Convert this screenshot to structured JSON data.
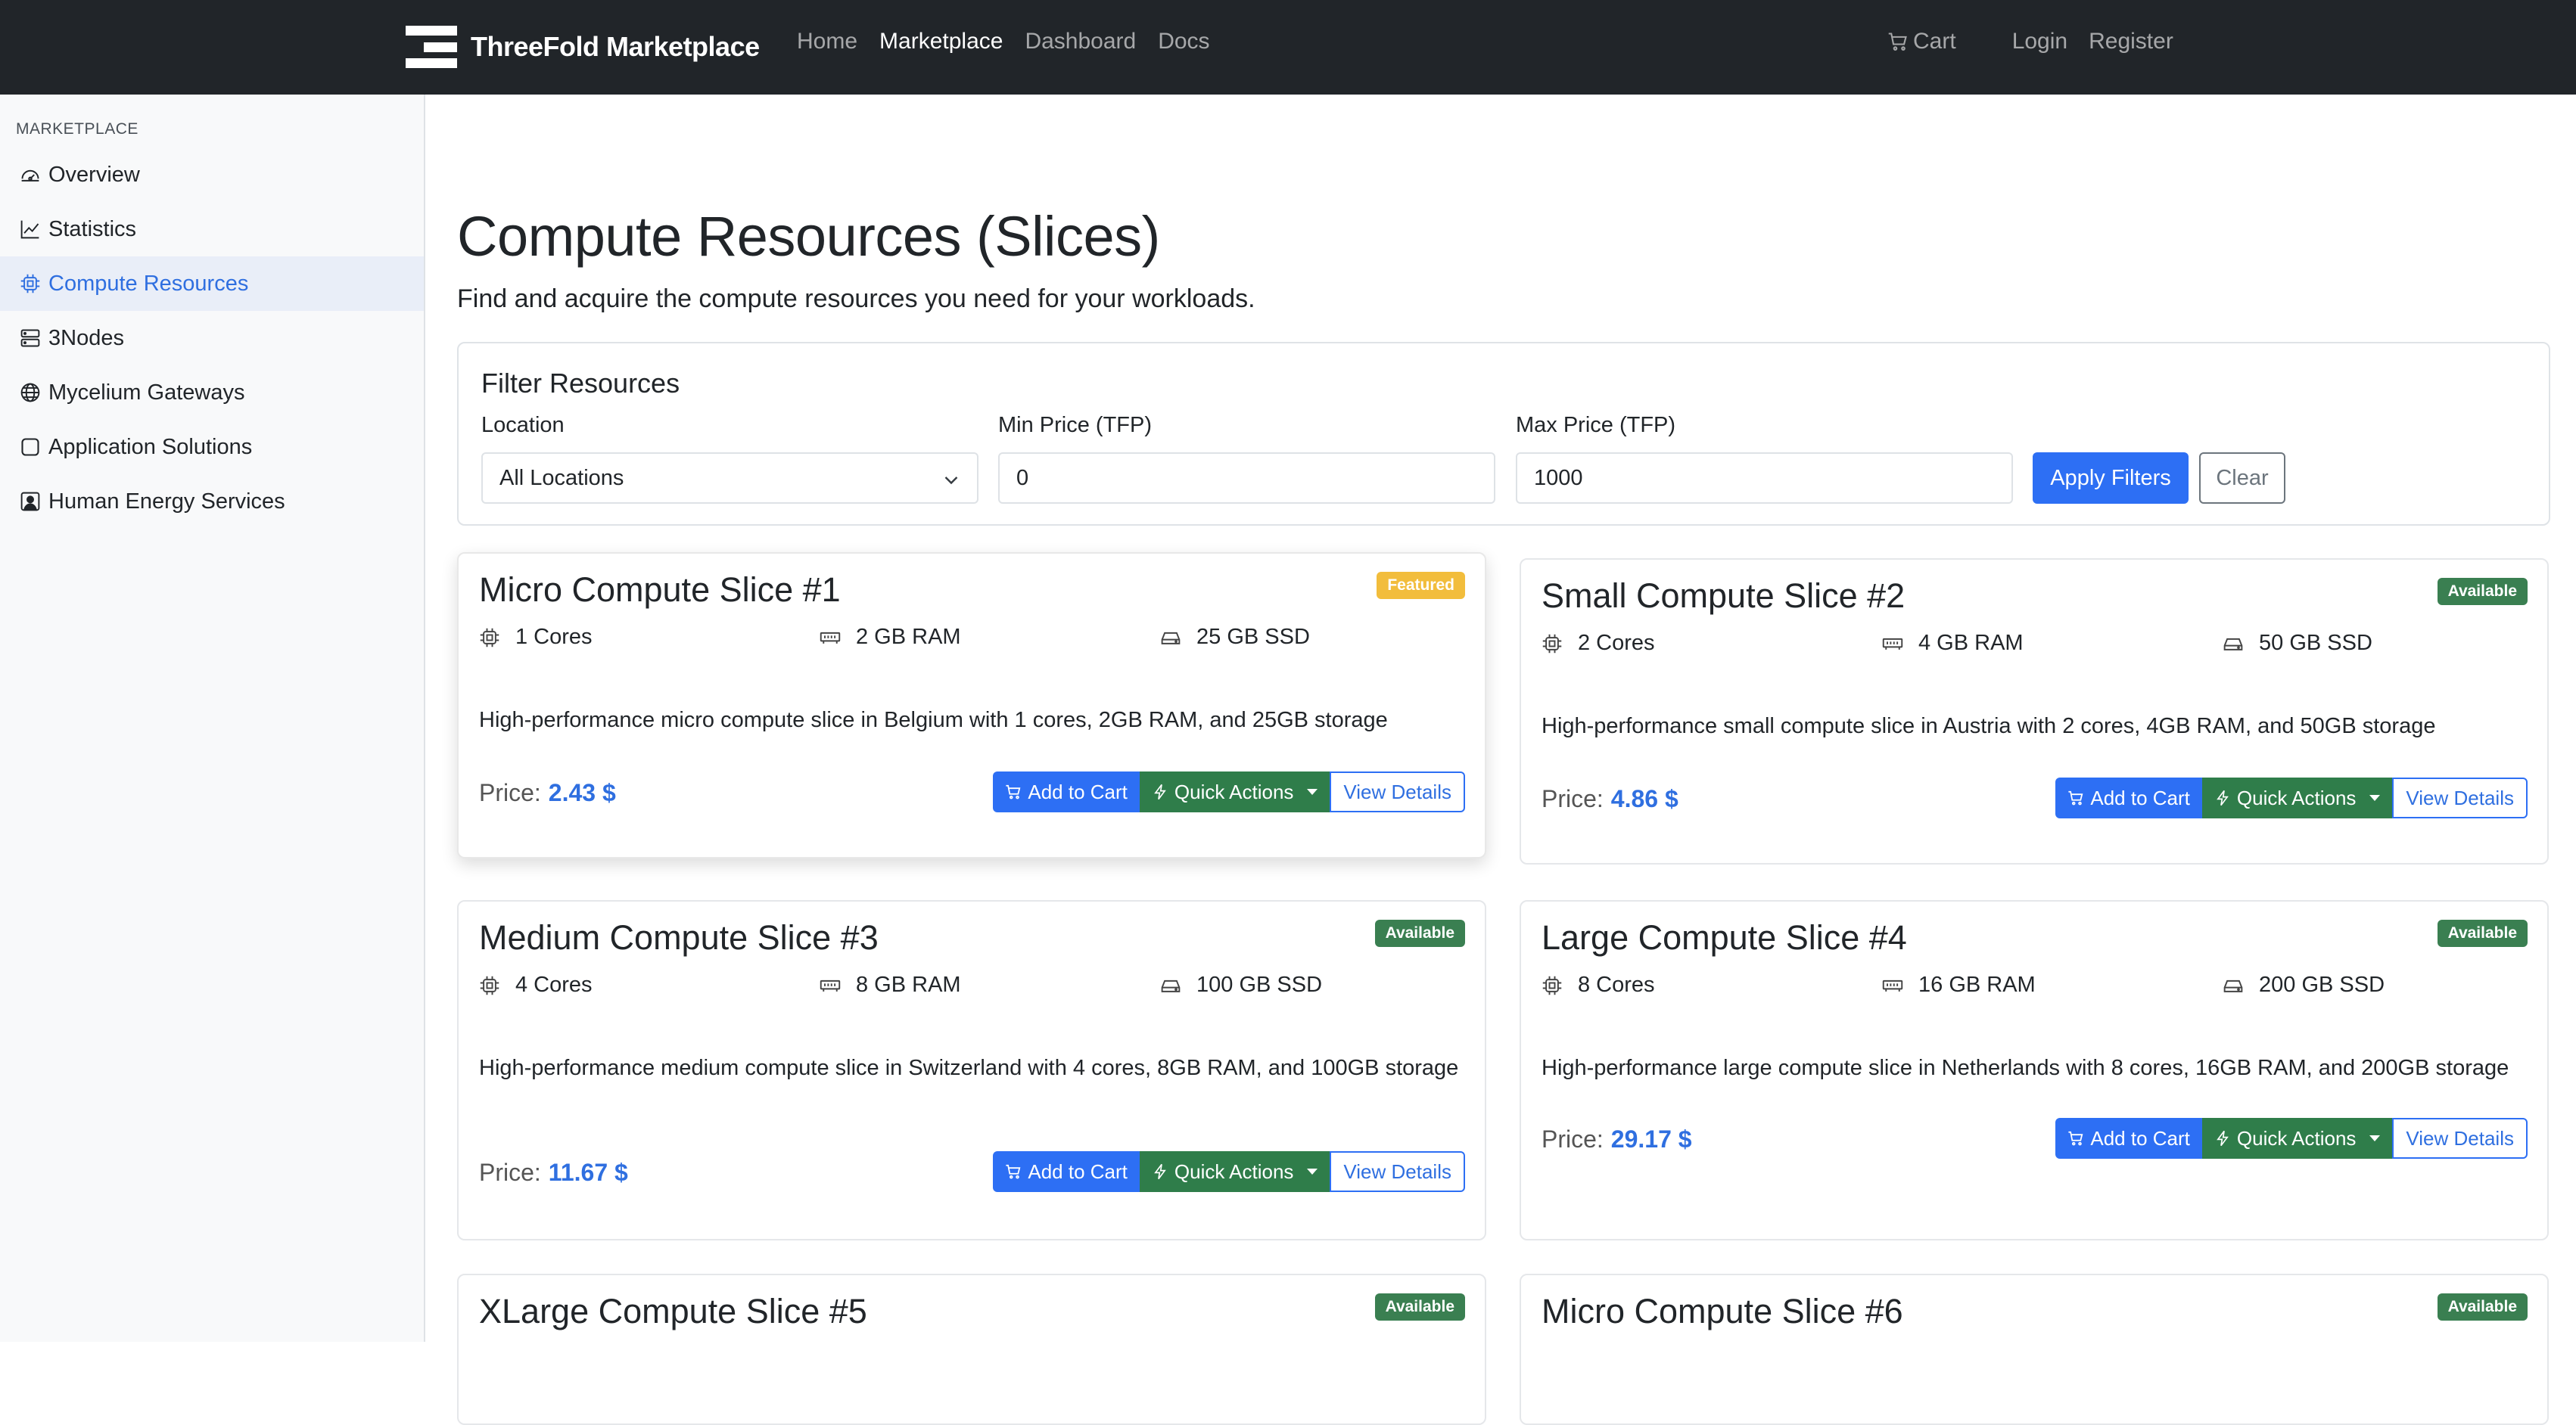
{
  "navbar": {
    "brand": "ThreeFold Marketplace",
    "links": [
      "Home",
      "Marketplace",
      "Dashboard",
      "Docs"
    ],
    "active": "Marketplace",
    "cart": "Cart",
    "login": "Login",
    "register": "Register"
  },
  "sidebar": {
    "heading": "MARKETPLACE",
    "items": [
      {
        "label": "Overview",
        "icon": "speedometer-icon"
      },
      {
        "label": "Statistics",
        "icon": "line-chart-icon"
      },
      {
        "label": "Compute Resources",
        "icon": "cpu-icon",
        "active": true
      },
      {
        "label": "3Nodes",
        "icon": "server-icon"
      },
      {
        "label": "Mycelium Gateways",
        "icon": "globe-icon"
      },
      {
        "label": "Application Solutions",
        "icon": "app-square-icon"
      },
      {
        "label": "Human Energy Services",
        "icon": "person-badge-icon"
      }
    ]
  },
  "main": {
    "title": "Compute Resources (Slices)",
    "subtitle": "Find and acquire the compute resources you need for your workloads."
  },
  "filters": {
    "title": "Filter Resources",
    "location_label": "Location",
    "location_value": "All Locations",
    "min_label": "Min Price (TFP)",
    "min_value": "0",
    "max_label": "Max Price (TFP)",
    "max_value": "1000",
    "apply": "Apply Filters",
    "clear": "Clear"
  },
  "card_common": {
    "price_label": "Price:",
    "add_to_cart": "Add to Cart",
    "quick_actions": "Quick Actions",
    "view_details": "View Details"
  },
  "cards": [
    {
      "title": "Micro Compute Slice #1",
      "badge": "Featured",
      "cores": "1 Cores",
      "ram": "2 GB RAM",
      "ssd": "25 GB SSD",
      "desc": "High-performance micro compute slice in Belgium with 1 cores, 2GB RAM, and 25GB storage",
      "price": "2.43 $"
    },
    {
      "title": "Small Compute Slice #2",
      "badge": "Available",
      "cores": "2 Cores",
      "ram": "4 GB RAM",
      "ssd": "50 GB SSD",
      "desc": "High-performance small compute slice in Austria with 2 cores, 4GB RAM, and 50GB storage",
      "price": "4.86 $"
    },
    {
      "title": "Medium Compute Slice #3",
      "badge": "Available",
      "cores": "4 Cores",
      "ram": "8 GB RAM",
      "ssd": "100 GB SSD",
      "desc": "High-performance medium compute slice in Switzerland with 4 cores, 8GB RAM, and 100GB storage",
      "price": "11.67 $"
    },
    {
      "title": "Large Compute Slice #4",
      "badge": "Available",
      "cores": "8 Cores",
      "ram": "16 GB RAM",
      "ssd": "200 GB SSD",
      "desc": "High-performance large compute slice in Netherlands with 8 cores, 16GB RAM, and 200GB storage",
      "price": "29.17 $"
    },
    {
      "title": "XLarge Compute Slice #5",
      "badge": "Available"
    },
    {
      "title": "Micro Compute Slice #6",
      "badge": "Available"
    }
  ],
  "colors": {
    "navbar_bg": "#212529",
    "primary": "#2d6ff4",
    "success": "#2f7d4a",
    "badge_available": "#3a7f51",
    "badge_featured": "#f2bd3c",
    "price": "#2f6fe0"
  }
}
